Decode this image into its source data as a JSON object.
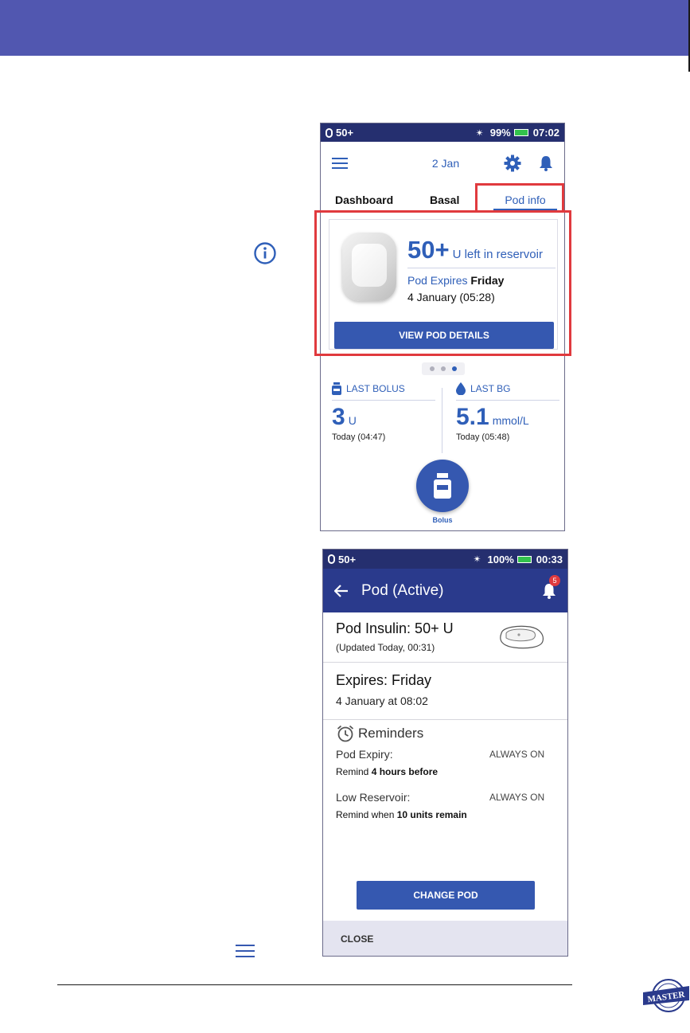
{
  "colors": {
    "banner": "#5157b0",
    "accent": "#2f5fb8",
    "status_bar": "#252f6f",
    "header_dark": "#2a3a8c",
    "highlight": "#e03a3e",
    "battery": "#33c24d"
  },
  "icons": {
    "page_info": "info-circle-icon",
    "page_menu": "menu-lines-icon",
    "badge": "master-badge"
  },
  "badge_text": "MASTER",
  "screen1": {
    "status": {
      "pod": "50+",
      "battery": "99%",
      "time": "07:02"
    },
    "header": {
      "date": "2 Jan"
    },
    "tabs": [
      {
        "label": "Dashboard"
      },
      {
        "label": "Basal"
      },
      {
        "label": "Pod info",
        "active": true
      }
    ],
    "card": {
      "reservoir_value": "50+",
      "reservoir_text": "U left in reservoir",
      "expires_label": "Pod Expires",
      "expires_day": "Friday",
      "expires_date": "4 January (05:28)",
      "button": "VIEW POD DETAILS"
    },
    "pager": {
      "pages": 3,
      "active_index": 2
    },
    "last_bolus": {
      "label": "LAST BOLUS",
      "value": "3",
      "unit": "U",
      "time": "Today (04:47)"
    },
    "last_bg": {
      "label": "LAST BG",
      "value": "5.1",
      "unit": "mmol/L",
      "time": "Today (05:48)"
    },
    "fab_label": "Bolus"
  },
  "screen2": {
    "status": {
      "pod": "50+",
      "battery": "100%",
      "time": "00:33"
    },
    "header": {
      "title": "Pod (Active)",
      "notification_count": "5"
    },
    "insulin": {
      "title": "Pod Insulin: 50+ U",
      "updated": "(Updated Today, 00:31)"
    },
    "expires": {
      "title": "Expires: Friday",
      "date": "4 January at 08:02"
    },
    "reminders": {
      "title": "Reminders",
      "items": [
        {
          "name": "Pod Expiry:",
          "desc_prefix": "Remind ",
          "desc_bold": "4 hours before",
          "status": "ALWAYS ON"
        },
        {
          "name": "Low Reservoir:",
          "desc_prefix": "Remind when ",
          "desc_bold": "10 units remain",
          "status": "ALWAYS ON"
        }
      ]
    },
    "change_button": "CHANGE POD",
    "close_label": "CLOSE"
  }
}
